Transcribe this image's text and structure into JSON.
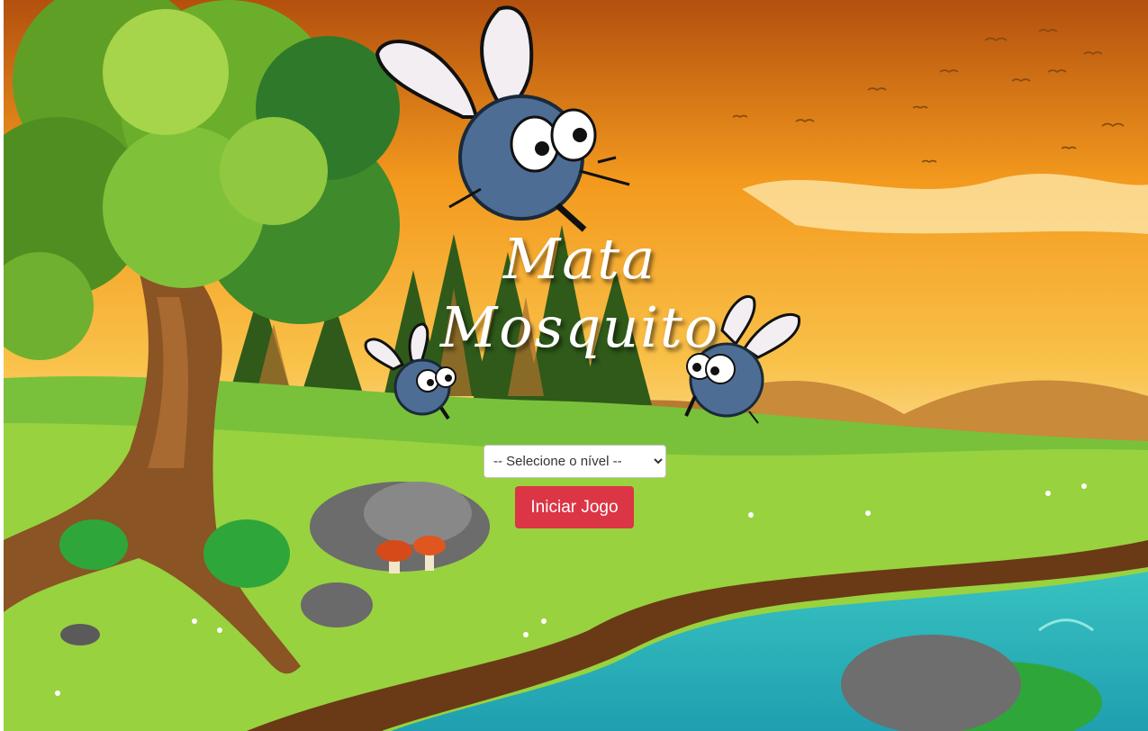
{
  "title": {
    "line1": "Mata",
    "line2": "Mosquito"
  },
  "level_select": {
    "selected": "-- Selecione o nível --"
  },
  "start_button": {
    "label": "Iniciar Jogo"
  },
  "colors": {
    "button_bg": "#dc3545",
    "sky_top": "#b8500f",
    "sky_mid": "#f5a020",
    "grass": "#8fd03b",
    "water": "#2ab5b0",
    "mosquito_body": "#4e6d94"
  },
  "icons": [
    "mosquito-icon",
    "tree-icon",
    "mushroom-icon",
    "rock-icon",
    "bird-icon"
  ]
}
